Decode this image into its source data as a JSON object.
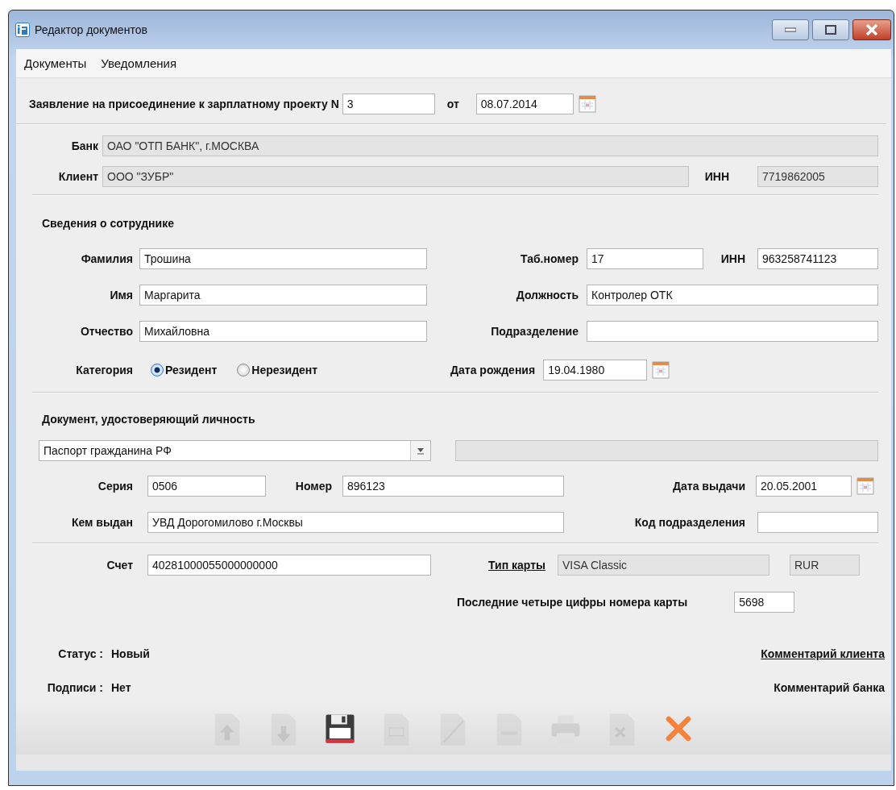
{
  "window": {
    "title": "Редактор документов"
  },
  "menu": [
    {
      "label": "Документы"
    },
    {
      "label": "Уведомления"
    }
  ],
  "application": {
    "title": "Заявление на присоединение к зарплатному проекту N",
    "number": {
      "kind": "text",
      "value": "3",
      "disabled": false
    },
    "date": {
      "label": "от",
      "kind": "date",
      "value": "08.07.2014",
      "disabled": false
    }
  },
  "bank": {
    "label": "Банк",
    "kind": "text",
    "value": "ОАО \"ОТП БАНК\", г.МОСКВА",
    "disabled": true
  },
  "client": {
    "label": "Клиент",
    "kind": "text",
    "value": "ООО \"ЗУБР\"",
    "disabled": true
  },
  "client_inn": {
    "label": "ИНН",
    "kind": "text",
    "value": "7719862005",
    "disabled": true
  },
  "employee": {
    "title": "Сведения о сотруднике",
    "surname": {
      "label": "Фамилия",
      "kind": "text",
      "value": "Трошина",
      "disabled": false
    },
    "tab_number": {
      "label": "Таб.номер",
      "kind": "text",
      "value": "17",
      "disabled": false
    },
    "inn": {
      "label": "ИНН",
      "kind": "text",
      "value": "963258741123",
      "disabled": false
    },
    "first_name": {
      "label": "Имя",
      "kind": "text",
      "value": "Маргарита",
      "disabled": false
    },
    "position": {
      "label": "Должность",
      "kind": "text",
      "value": "Контролер ОТК",
      "disabled": false
    },
    "patronymic": {
      "label": "Отчество",
      "kind": "text",
      "value": "Михайловна",
      "disabled": false
    },
    "department": {
      "label": "Подразделение",
      "kind": "text",
      "disabled": false
    },
    "category": {
      "label": "Категория",
      "options": [
        {
          "label": "Резидент",
          "selected": true
        },
        {
          "label": "Нерезидент",
          "selected": false
        }
      ]
    },
    "birth_date": {
      "label": "Дата рождения",
      "kind": "date",
      "value": "19.04.1980",
      "disabled": false
    }
  },
  "identity_document": {
    "title": "Документ, удостоверяющий личность",
    "type": {
      "kind": "combo",
      "value": "Паспорт гражданина РФ",
      "disabled": false
    },
    "note": {
      "kind": "text",
      "disabled": true
    },
    "series": {
      "label": "Серия",
      "kind": "text",
      "value": "0506",
      "disabled": false
    },
    "number": {
      "label": "Номер",
      "kind": "text",
      "value": "896123",
      "disabled": false
    },
    "issue_date": {
      "label": "Дата выдачи",
      "kind": "date",
      "value": "20.05.2001",
      "disabled": false
    },
    "issued_by": {
      "label": "Кем выдан",
      "kind": "text",
      "value": "УВД Дорогомилово г.Москвы",
      "disabled": false
    },
    "division_code": {
      "label": "Код подразделения",
      "kind": "text",
      "disabled": false
    }
  },
  "card": {
    "account": {
      "label": "Счет",
      "kind": "text",
      "value": "40281000055000000000",
      "disabled": false
    },
    "card_type": {
      "label": "Тип карты",
      "kind": "text",
      "value": "VISA Classic",
      "disabled": true
    },
    "currency": {
      "kind": "text",
      "value": "RUR",
      "disabled": true
    },
    "last_digits": {
      "label": "Последние четыре цифры номера карты",
      "kind": "text",
      "value": "5698",
      "disabled": false
    }
  },
  "status": {
    "label": "Статус :",
    "value": "Новый"
  },
  "signatures": {
    "label": "Подписи :",
    "value": "Нет"
  },
  "comments": [
    {
      "label": "Комментарий клиента",
      "link": true
    },
    {
      "label": "Комментарий банка",
      "link": false
    }
  ],
  "toolbar": [
    {
      "kind": "up",
      "disabled": true
    },
    {
      "kind": "down",
      "disabled": true
    },
    {
      "kind": "save",
      "disabled": false
    },
    {
      "kind": "document",
      "disabled": true
    },
    {
      "kind": "sign",
      "disabled": true
    },
    {
      "kind": "copy",
      "disabled": true
    },
    {
      "kind": "print",
      "disabled": true
    },
    {
      "kind": "delete",
      "disabled": true
    },
    {
      "kind": "cancel",
      "disabled": false
    }
  ]
}
